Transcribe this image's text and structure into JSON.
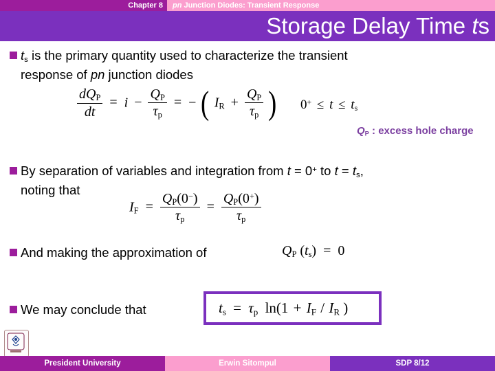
{
  "header": {
    "chapter_label": "Chapter 8",
    "chapter_title_italic": "pn",
    "chapter_title_rest": " Junction Diodes: Transient Response",
    "colors": {
      "magenta": "#9c1d9c",
      "pink": "#fb9ece",
      "purple": "#7b30be"
    }
  },
  "title": {
    "main": "Storage Delay Time ",
    "var_italic": "t",
    "var_sub": "s"
  },
  "bullets": [
    {
      "id": "bullet-ts-primary",
      "line1_var": "t",
      "line1_sub": "s",
      "line1_rest": " is the primary quantity used to characterize the transient",
      "line2_a": "response of ",
      "line2_italic": "pn",
      "line2_b": " junction diodes"
    },
    {
      "id": "bullet-separation-of-variables",
      "part_a": "By separation of variables and integration from ",
      "var1": "t",
      "eq1": " = 0",
      "sup1": "+",
      "mid": " to ",
      "var2": "t",
      "eq2": " = ",
      "var3": "t",
      "sub3": "s",
      "tail": ",",
      "line2": "noting that"
    },
    {
      "id": "bullet-approximation",
      "text": "And making the approximation of"
    },
    {
      "id": "bullet-conclusion",
      "text": "We may conclude that"
    }
  ],
  "annotation": {
    "symbol": "Q",
    "symbol_sub": "P",
    "text": " : excess hole charge",
    "color": "#7b3fa0"
  },
  "equations": {
    "charge_rate": {
      "lhs_num_d": "d",
      "lhs_num_Q": "Q",
      "lhs_num_sub": "P",
      "lhs_den": "dt",
      "eq1": "=",
      "i": "i",
      "minus": "−",
      "Q": "Q",
      "Q_sub": "P",
      "tau": "τ",
      "tau_sub": "p",
      "eq2": "=",
      "neg": "−",
      "open_paren": "(",
      "IR": "I",
      "IR_sub": "R",
      "plus": "+",
      "close_paren": ")"
    },
    "time_range": {
      "zero": "0",
      "zero_sup": "+",
      "le1": "≤",
      "t": "t",
      "le2": "≤",
      "ts": "t",
      "ts_sub": "s"
    },
    "forward_current": {
      "IF": "I",
      "IF_sub": "F",
      "eq1": "=",
      "Q1": "Q",
      "Q1_sub": "P",
      "arg1_open": "(0",
      "arg1_sup": "−",
      "arg1_close": ")",
      "tau1": "τ",
      "tau1_sub": "p",
      "eq2": "=",
      "Q2": "Q",
      "Q2_sub": "P",
      "arg2_open": "(0",
      "arg2_sup": "+",
      "arg2_close": ")",
      "tau2": "τ",
      "tau2_sub": "p"
    },
    "approximation": {
      "Q": "Q",
      "Q_sub": "P",
      "open": "(",
      "t": "t",
      "t_sub": "s",
      "close": ")",
      "eq": "=",
      "zero": "0"
    },
    "storage_time": {
      "ts": "t",
      "ts_sub": "s",
      "eq": "=",
      "tau": "τ",
      "tau_sub": "p",
      "ln": "ln(1",
      "plus": "+",
      "IF": "I",
      "IF_sub": "F",
      "slash": "/",
      "IR": "I",
      "IR_sub": "R",
      "close": ")"
    }
  },
  "footer": {
    "left": "President University",
    "center": "Erwin Sitompul",
    "right": "SDP 8/12"
  }
}
